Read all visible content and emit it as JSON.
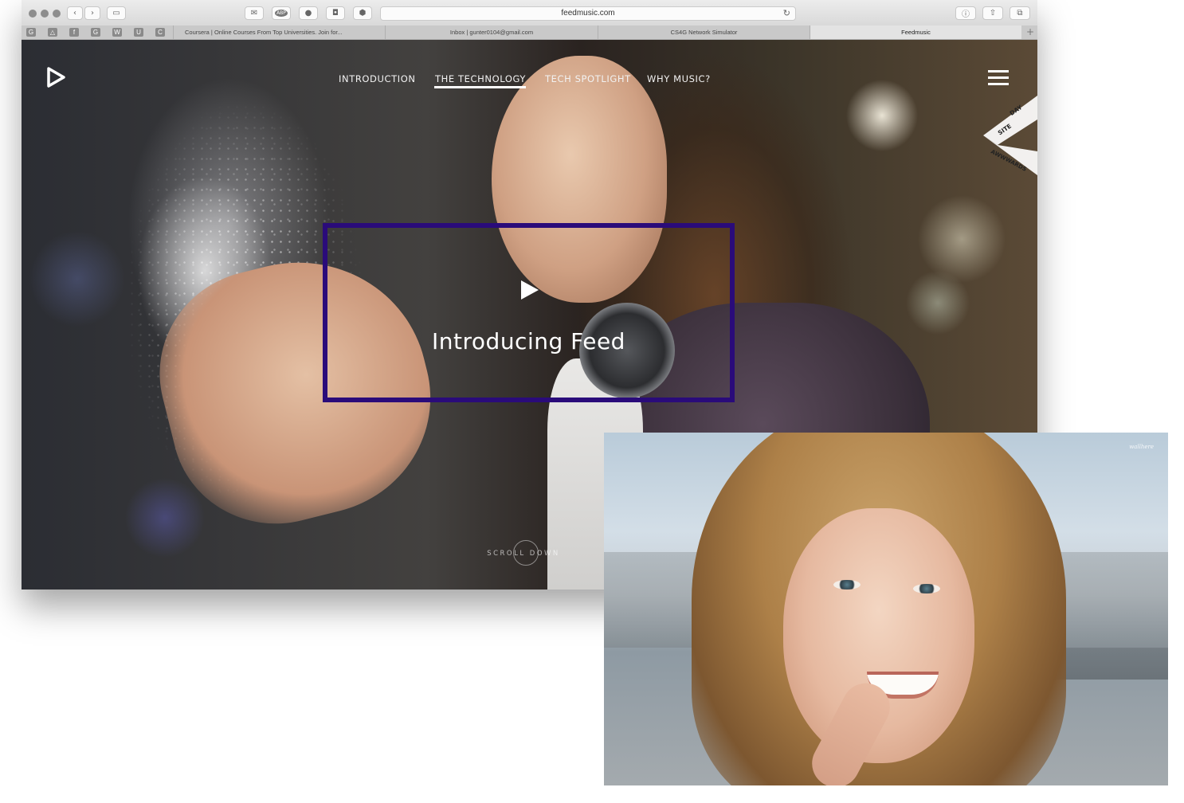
{
  "browser": {
    "url": "feedmusic.com",
    "toolbar_icons": [
      "mail-icon",
      "abp-icon",
      "ghostery-icon",
      "pocket-icon",
      "extension-icon"
    ],
    "abp_label": "ABP",
    "favicons": [
      "G",
      "△",
      "f",
      "G",
      "W",
      "U",
      "C"
    ],
    "tabs": [
      {
        "title": "Coursera | Online Courses From Top Universities. Join for...",
        "active": false
      },
      {
        "title": "Inbox | gunter0104@gmail.com",
        "active": false
      },
      {
        "title": "CS4G Network Simulator",
        "active": false
      },
      {
        "title": "Feedmusic",
        "active": true
      }
    ],
    "new_tab_label": "+"
  },
  "site": {
    "nav": [
      {
        "label": "INTRODUCTION",
        "active": false
      },
      {
        "label": "THE TECHNOLOGY",
        "active": true
      },
      {
        "label": "TECH SPOTLIGHT",
        "active": false
      },
      {
        "label": "WHY MUSIC?",
        "active": false
      }
    ],
    "award_line1": "SITE",
    "award_line2": "DAY",
    "award_line3": "AWWWARDS",
    "hero_title": "Introducing Feed",
    "scroll_label": "SCROLL DOWN"
  },
  "overlay_photo": {
    "watermark": "wallhere",
    "description_icon": "portrait-photo"
  },
  "colors": {
    "highlight_border": "#2a0b7a",
    "nav_text": "#f2f2f2"
  }
}
